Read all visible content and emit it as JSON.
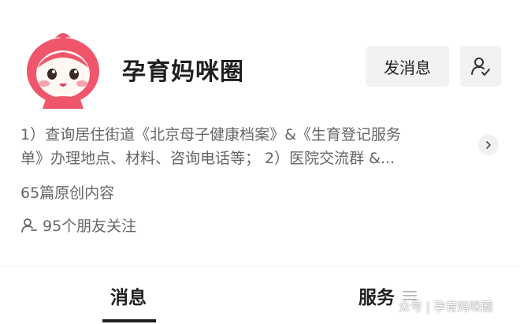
{
  "profile": {
    "name": "孕育妈咪圈",
    "send_message_label": "发消息",
    "description_lines": [
      "1）查询居住街道《北京母子健康档案》&《生育登记服务",
      "单》办理地点、材料、咨询电话等；  2）医院交流群 &..."
    ],
    "original_count": "65篇原创内容",
    "friends_following": "95个朋友关注"
  },
  "tabs": [
    {
      "label": "消息",
      "active": true
    },
    {
      "label": "服务",
      "active": false
    }
  ],
  "watermark": "众号 | 孕育妈咪圈",
  "icons": {
    "avatar": "strawberry-girl-avatar",
    "user_settings": "user-check-icon",
    "expand": "chevron-right-icon",
    "friends": "person-icon",
    "menu": "hamburger-menu-icon"
  },
  "colors": {
    "avatar_hood": "#f0566b",
    "button_bg": "#f2f2f2",
    "secondary_text": "#666666"
  }
}
